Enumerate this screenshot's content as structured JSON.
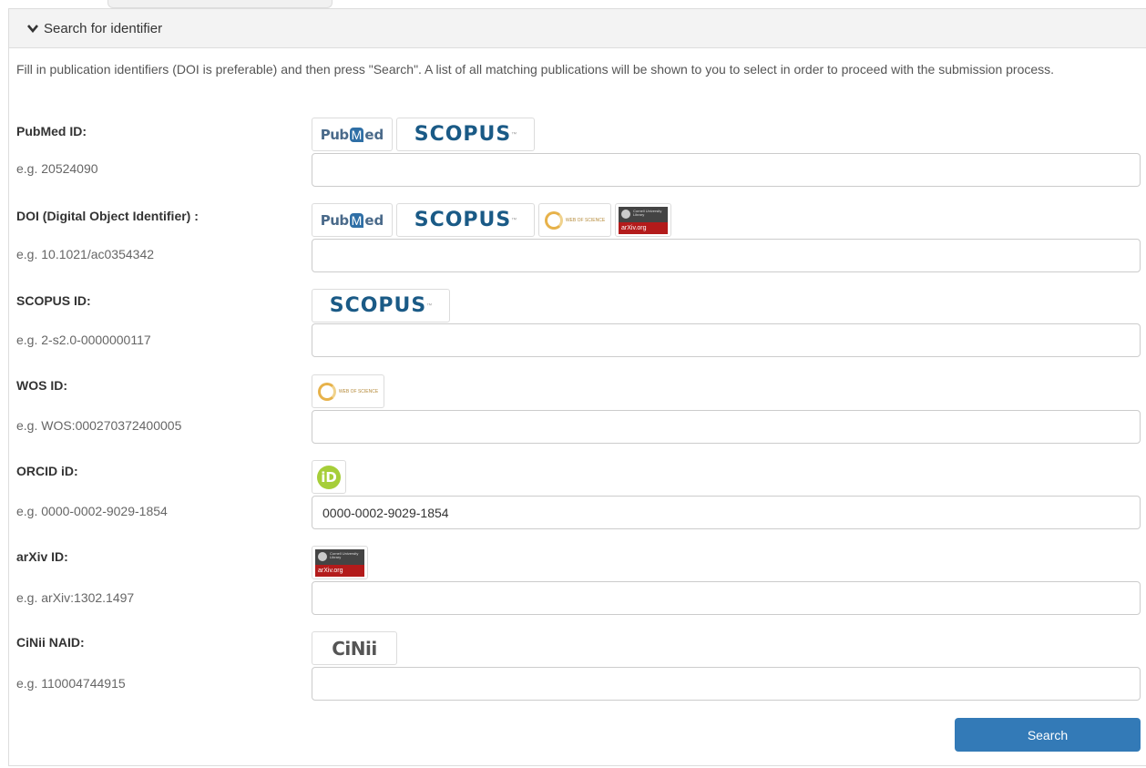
{
  "panel": {
    "title": "Search for identifier",
    "intro": "Fill in publication identifiers (DOI is preferable) and then press \"Search\". A list of all matching publications will be shown to you to select in order to proceed with the submission process."
  },
  "logos": {
    "pub": "Pub",
    "med_m": "M",
    "med": "ed",
    "scopus": "SCOPUS",
    "tm": "™",
    "wos": "WEB OF SCIENCE",
    "arxiv": "arXiv.org",
    "cornell": "Cornell University Library",
    "orcid": "iD",
    "cinii": "CiNii"
  },
  "rows": [
    {
      "label": "PubMed ID:",
      "example": "e.g. 20524090",
      "value": ""
    },
    {
      "label": "DOI (Digital Object Identifier) :",
      "example": "e.g. 10.1021/ac0354342",
      "value": ""
    },
    {
      "label": "SCOPUS ID:",
      "example": "e.g. 2-s2.0-0000000117",
      "value": ""
    },
    {
      "label": "WOS ID:",
      "example": "e.g. WOS:000270372400005",
      "value": ""
    },
    {
      "label": "ORCID iD:",
      "example": "e.g. 0000-0002-9029-1854",
      "value": "0000-0002-9029-1854"
    },
    {
      "label": "arXiv ID:",
      "example": "e.g. arXiv:1302.1497",
      "value": ""
    },
    {
      "label": "CiNii NAID:",
      "example": "e.g. 110004744915",
      "value": ""
    }
  ],
  "search_button": "Search",
  "icons": {
    "collapse": "chevron-down-icon"
  },
  "colors": {
    "button": "#337ab7",
    "header_bg": "#f3f3f3"
  }
}
